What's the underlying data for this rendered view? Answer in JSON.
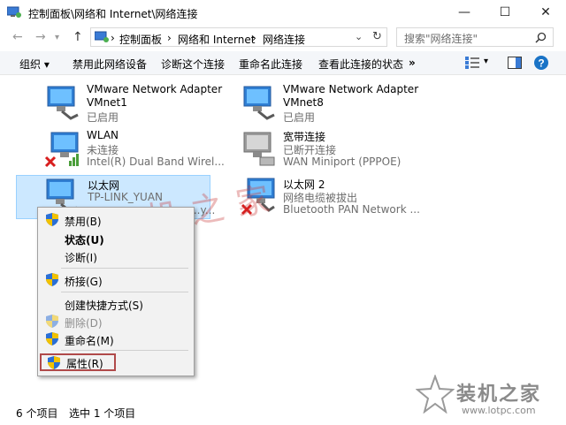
{
  "window": {
    "title": "控制面板\\网络和 Internet\\网络连接"
  },
  "address": {
    "crumbs": [
      "控制面板",
      "网络和 Internet",
      "网络连接"
    ],
    "sep": "›"
  },
  "search": {
    "placeholder": "搜索\"网络连接\""
  },
  "toolbar": {
    "organize": "组织 ▾",
    "disable": "禁用此网络设备",
    "diagnose": "诊断这个连接",
    "rename": "重命名此连接",
    "status": "查看此连接的状态",
    "more": "»"
  },
  "items": [
    {
      "name": "VMware Network Adapter",
      "name2": "VMnet1",
      "sub1": "已启用",
      "sub2": ""
    },
    {
      "name": "VMware Network Adapter",
      "name2": "VMnet8",
      "sub1": "已启用",
      "sub2": ""
    },
    {
      "name": "WLAN",
      "name2": "",
      "sub1": "未连接",
      "sub2": "Intel(R) Dual Band Wirel..."
    },
    {
      "name": "宽带连接",
      "name2": "",
      "sub1": "已断开连接",
      "sub2": "WAN Miniport (PPPOE)"
    },
    {
      "name": "以太网",
      "name2": "",
      "sub1": "TP-LINK_YUAN",
      "sub2": "...y..."
    },
    {
      "name": "以太网 2",
      "name2": "",
      "sub1": "网络电缆被拔出",
      "sub2": "Bluetooth PAN Network ..."
    }
  ],
  "menu": {
    "disable": "禁用(B)",
    "status": "状态(U)",
    "diagnose": "诊断(I)",
    "bridge": "桥接(G)",
    "shortcut": "创建快捷方式(S)",
    "delete": "删除(D)",
    "rename": "重命名(M)",
    "properties": "属性(R)"
  },
  "statusbar": {
    "count": "6 个项目",
    "selected": "选中 1 个项目"
  },
  "watermark": {
    "text": "装机之家"
  },
  "brand": {
    "name": "装机之家",
    "url": "www.lotpc.com"
  },
  "colors": {
    "selection": "#cce8ff",
    "selection_border": "#99d1ff",
    "highlight_box": "#b04a4a",
    "link_blue": "#1a73c6"
  }
}
